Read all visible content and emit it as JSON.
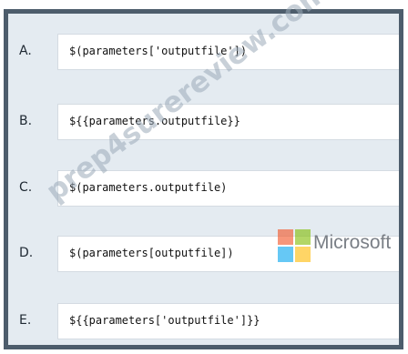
{
  "options": [
    {
      "letter": "A.",
      "code": "$(parameters['outputfile'])"
    },
    {
      "letter": "B.",
      "code": "${{parameters.outputfile}}"
    },
    {
      "letter": "C.",
      "code": "$(parameters.outputfile)"
    },
    {
      "letter": "D.",
      "code": "$(parameters[outputfile])"
    },
    {
      "letter": "E.",
      "code": "${{parameters['outputfile']}}"
    }
  ],
  "watermark": "prep4surereview.com",
  "microsoft_logo": {
    "text": "Microsoft",
    "colors": [
      "#f25022",
      "#7fba00",
      "#00a4ef",
      "#ffb900"
    ]
  }
}
